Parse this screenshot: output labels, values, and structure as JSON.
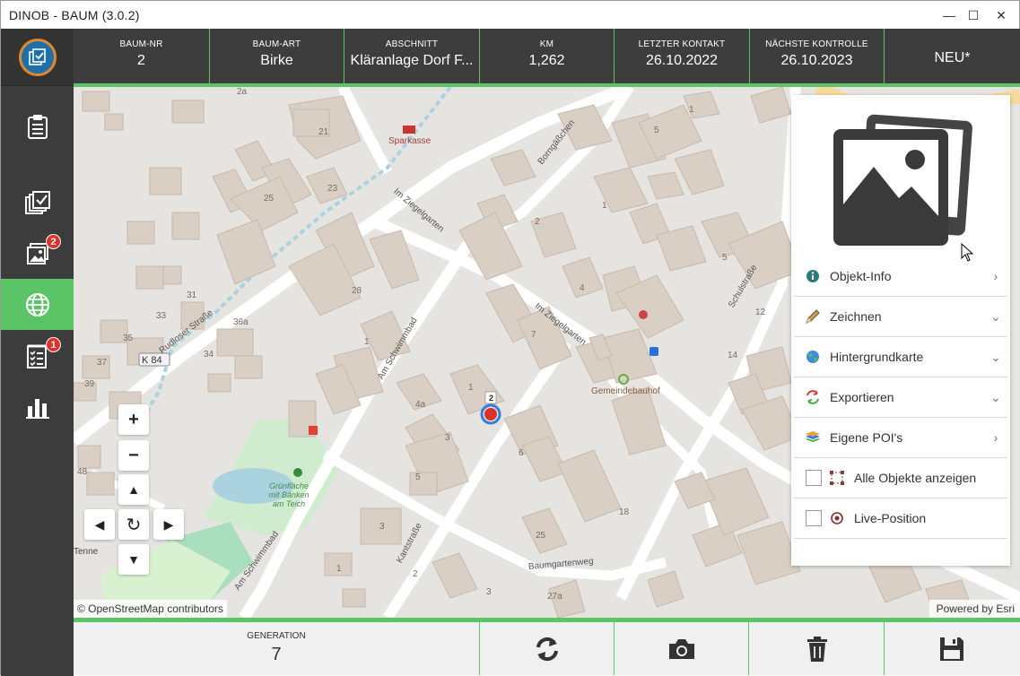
{
  "window": {
    "title": "DINOB - BAUM (3.0.2)",
    "controls": [
      "—",
      "☐",
      "✕"
    ]
  },
  "sidebar": {
    "items": [
      {
        "icon": "clipboard-icon"
      },
      {
        "icon": "checked-stack-icon"
      },
      {
        "icon": "photos-icon",
        "badge": "2"
      },
      {
        "icon": "globe-icon",
        "active": true
      },
      {
        "icon": "checklist-icon",
        "badge": "1"
      },
      {
        "icon": "bar-chart-icon"
      }
    ]
  },
  "header": {
    "baum_nr": {
      "label": "BAUM-NR",
      "value": "2"
    },
    "baum_art": {
      "label": "BAUM-ART",
      "value": "Birke"
    },
    "abschnitt": {
      "label": "ABSCHNITT",
      "value": "Kläranlage Dorf  F..."
    },
    "km": {
      "label": "KM",
      "value": "1,262"
    },
    "letzter_kontakt": {
      "label": "LETZTER KONTAKT",
      "value": "26.10.2022"
    },
    "naechste_kontrolle": {
      "label": "NÄCHSTE KONTROLLE",
      "value": "26.10.2023"
    },
    "status": {
      "value": "NEU*"
    }
  },
  "map": {
    "attribution_left": "© OpenStreetMap contributors",
    "attribution_right": "Powered by Esri",
    "marker_label": "2",
    "labels": {
      "sparkasse": "Sparkasse",
      "gemeindebauhof": "Gemeindebauhof",
      "gruenflaeche": "Grünfläche\nmit Bänken\nam Teich",
      "k84": "K 84",
      "tenne": "Tenne"
    },
    "streets": {
      "borngasschen": "Borngäßchen",
      "im_ziegelgarten_1": "Im Ziegelgarten",
      "im_ziegelgarten_2": "Im Ziegelgarten",
      "rudloser_strasse": "Rudloser Straße",
      "am_schwimmbad_1": "Am Schwimmbad",
      "am_schwimmbad_2": "Am Schwimmbad",
      "kantstrasse": "Kantstraße",
      "baumgartenweg": "Baumgartenweg",
      "schulstrasse": "Schulstraße"
    },
    "house_numbers": [
      "21",
      "23",
      "25",
      "2a",
      "31",
      "33",
      "35",
      "36a",
      "37",
      "39",
      "28",
      "34",
      "1",
      "7",
      "1",
      "2",
      "4",
      "5",
      "4a",
      "3",
      "5",
      "6",
      "3",
      "25",
      "18",
      "12",
      "14",
      "5",
      "1",
      "27a",
      "48",
      "1",
      "2",
      "1",
      "3"
    ]
  },
  "panel": {
    "items": [
      {
        "label": "Objekt-Info",
        "icon": "info-icon",
        "chevron": "›"
      },
      {
        "label": "Zeichnen",
        "icon": "pencil-icon",
        "chevron": "⌄"
      },
      {
        "label": "Hintergrundkarte",
        "icon": "globe-icon",
        "chevron": "⌄"
      },
      {
        "label": "Exportieren",
        "icon": "export-icon",
        "chevron": "⌄"
      },
      {
        "label": "Eigene POI's",
        "icon": "layers-icon",
        "chevron": "›"
      },
      {
        "label": "Alle Objekte anzeigen",
        "icon": "select-all-icon",
        "checkbox": true,
        "checked": false
      },
      {
        "label": "Live-Position",
        "icon": "target-icon",
        "checkbox": true,
        "checked": false
      }
    ]
  },
  "bottom": {
    "generation": {
      "label": "GENERATION",
      "value": "7"
    },
    "buttons": [
      "refresh-icon",
      "camera-icon",
      "trash-icon",
      "save-icon"
    ]
  },
  "colors": {
    "accent_green": "#5bc466",
    "sidebar_bg": "#3c3c3c",
    "header_bg": "#3d3d3d",
    "badge_red": "#e0322d",
    "marker_red": "#d7322b",
    "marker_blue": "#2f7fd8"
  }
}
